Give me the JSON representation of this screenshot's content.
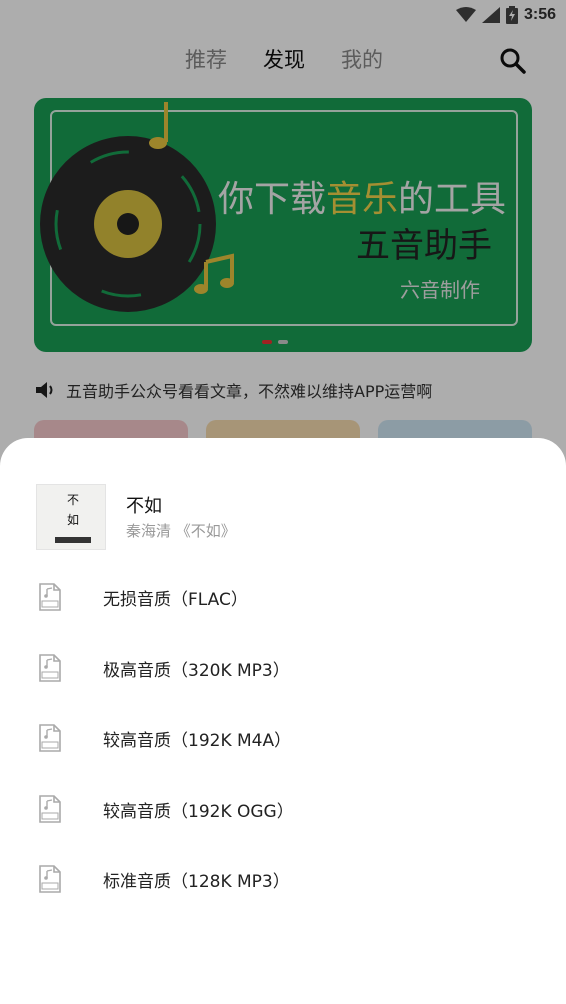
{
  "status_bar": {
    "time": "3:56"
  },
  "nav": {
    "tabs": [
      {
        "label": "推荐",
        "active": false
      },
      {
        "label": "发现",
        "active": true
      },
      {
        "label": "我的",
        "active": false
      }
    ]
  },
  "banner": {
    "line1_a": "你下载",
    "line1_b": "音乐",
    "line1_c": "的工具",
    "line2": "五音助手",
    "line3": "六音制作"
  },
  "notice": {
    "text": "五音助手公众号看看文章，不然难以维持APP运营啊"
  },
  "sheet": {
    "song": {
      "title": "不如",
      "subtitle": "秦海清 《不如》",
      "cover_text_1": "不",
      "cover_text_2": "如"
    },
    "qualities": [
      {
        "label": "无损音质（FLAC）",
        "badge": "FLAC"
      },
      {
        "label": "极高音质（320K MP3）",
        "badge": "MP3"
      },
      {
        "label": "较高音质（192K M4A）",
        "badge": "M4A"
      },
      {
        "label": "较高音质（192K OGG）",
        "badge": "OGG"
      },
      {
        "label": "标准音质（128K MP3）",
        "badge": "MP3"
      }
    ]
  },
  "colors": {
    "banner_green": "#1a9e55",
    "highlight_yellow": "#f3d34a",
    "scrim": "rgba(0,0,0,0.32)"
  }
}
